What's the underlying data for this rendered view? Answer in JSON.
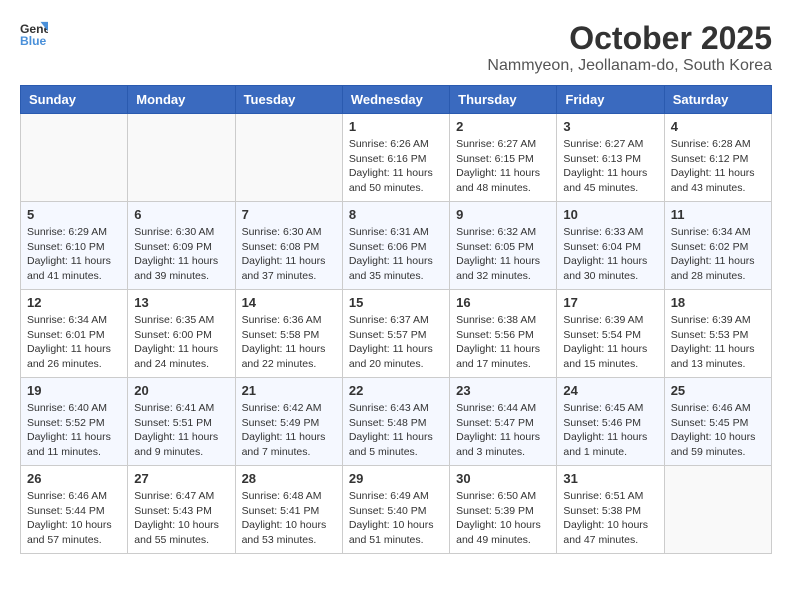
{
  "logo": {
    "text_general": "General",
    "text_blue": "Blue"
  },
  "header": {
    "title": "October 2025",
    "subtitle": "Nammyeon, Jeollanam-do, South Korea"
  },
  "weekdays": [
    "Sunday",
    "Monday",
    "Tuesday",
    "Wednesday",
    "Thursday",
    "Friday",
    "Saturday"
  ],
  "weeks": [
    [
      {
        "day": "",
        "info": ""
      },
      {
        "day": "",
        "info": ""
      },
      {
        "day": "",
        "info": ""
      },
      {
        "day": "1",
        "info": "Sunrise: 6:26 AM\nSunset: 6:16 PM\nDaylight: 11 hours\nand 50 minutes."
      },
      {
        "day": "2",
        "info": "Sunrise: 6:27 AM\nSunset: 6:15 PM\nDaylight: 11 hours\nand 48 minutes."
      },
      {
        "day": "3",
        "info": "Sunrise: 6:27 AM\nSunset: 6:13 PM\nDaylight: 11 hours\nand 45 minutes."
      },
      {
        "day": "4",
        "info": "Sunrise: 6:28 AM\nSunset: 6:12 PM\nDaylight: 11 hours\nand 43 minutes."
      }
    ],
    [
      {
        "day": "5",
        "info": "Sunrise: 6:29 AM\nSunset: 6:10 PM\nDaylight: 11 hours\nand 41 minutes."
      },
      {
        "day": "6",
        "info": "Sunrise: 6:30 AM\nSunset: 6:09 PM\nDaylight: 11 hours\nand 39 minutes."
      },
      {
        "day": "7",
        "info": "Sunrise: 6:30 AM\nSunset: 6:08 PM\nDaylight: 11 hours\nand 37 minutes."
      },
      {
        "day": "8",
        "info": "Sunrise: 6:31 AM\nSunset: 6:06 PM\nDaylight: 11 hours\nand 35 minutes."
      },
      {
        "day": "9",
        "info": "Sunrise: 6:32 AM\nSunset: 6:05 PM\nDaylight: 11 hours\nand 32 minutes."
      },
      {
        "day": "10",
        "info": "Sunrise: 6:33 AM\nSunset: 6:04 PM\nDaylight: 11 hours\nand 30 minutes."
      },
      {
        "day": "11",
        "info": "Sunrise: 6:34 AM\nSunset: 6:02 PM\nDaylight: 11 hours\nand 28 minutes."
      }
    ],
    [
      {
        "day": "12",
        "info": "Sunrise: 6:34 AM\nSunset: 6:01 PM\nDaylight: 11 hours\nand 26 minutes."
      },
      {
        "day": "13",
        "info": "Sunrise: 6:35 AM\nSunset: 6:00 PM\nDaylight: 11 hours\nand 24 minutes."
      },
      {
        "day": "14",
        "info": "Sunrise: 6:36 AM\nSunset: 5:58 PM\nDaylight: 11 hours\nand 22 minutes."
      },
      {
        "day": "15",
        "info": "Sunrise: 6:37 AM\nSunset: 5:57 PM\nDaylight: 11 hours\nand 20 minutes."
      },
      {
        "day": "16",
        "info": "Sunrise: 6:38 AM\nSunset: 5:56 PM\nDaylight: 11 hours\nand 17 minutes."
      },
      {
        "day": "17",
        "info": "Sunrise: 6:39 AM\nSunset: 5:54 PM\nDaylight: 11 hours\nand 15 minutes."
      },
      {
        "day": "18",
        "info": "Sunrise: 6:39 AM\nSunset: 5:53 PM\nDaylight: 11 hours\nand 13 minutes."
      }
    ],
    [
      {
        "day": "19",
        "info": "Sunrise: 6:40 AM\nSunset: 5:52 PM\nDaylight: 11 hours\nand 11 minutes."
      },
      {
        "day": "20",
        "info": "Sunrise: 6:41 AM\nSunset: 5:51 PM\nDaylight: 11 hours\nand 9 minutes."
      },
      {
        "day": "21",
        "info": "Sunrise: 6:42 AM\nSunset: 5:49 PM\nDaylight: 11 hours\nand 7 minutes."
      },
      {
        "day": "22",
        "info": "Sunrise: 6:43 AM\nSunset: 5:48 PM\nDaylight: 11 hours\nand 5 minutes."
      },
      {
        "day": "23",
        "info": "Sunrise: 6:44 AM\nSunset: 5:47 PM\nDaylight: 11 hours\nand 3 minutes."
      },
      {
        "day": "24",
        "info": "Sunrise: 6:45 AM\nSunset: 5:46 PM\nDaylight: 11 hours\nand 1 minute."
      },
      {
        "day": "25",
        "info": "Sunrise: 6:46 AM\nSunset: 5:45 PM\nDaylight: 10 hours\nand 59 minutes."
      }
    ],
    [
      {
        "day": "26",
        "info": "Sunrise: 6:46 AM\nSunset: 5:44 PM\nDaylight: 10 hours\nand 57 minutes."
      },
      {
        "day": "27",
        "info": "Sunrise: 6:47 AM\nSunset: 5:43 PM\nDaylight: 10 hours\nand 55 minutes."
      },
      {
        "day": "28",
        "info": "Sunrise: 6:48 AM\nSunset: 5:41 PM\nDaylight: 10 hours\nand 53 minutes."
      },
      {
        "day": "29",
        "info": "Sunrise: 6:49 AM\nSunset: 5:40 PM\nDaylight: 10 hours\nand 51 minutes."
      },
      {
        "day": "30",
        "info": "Sunrise: 6:50 AM\nSunset: 5:39 PM\nDaylight: 10 hours\nand 49 minutes."
      },
      {
        "day": "31",
        "info": "Sunrise: 6:51 AM\nSunset: 5:38 PM\nDaylight: 10 hours\nand 47 minutes."
      },
      {
        "day": "",
        "info": ""
      }
    ]
  ]
}
